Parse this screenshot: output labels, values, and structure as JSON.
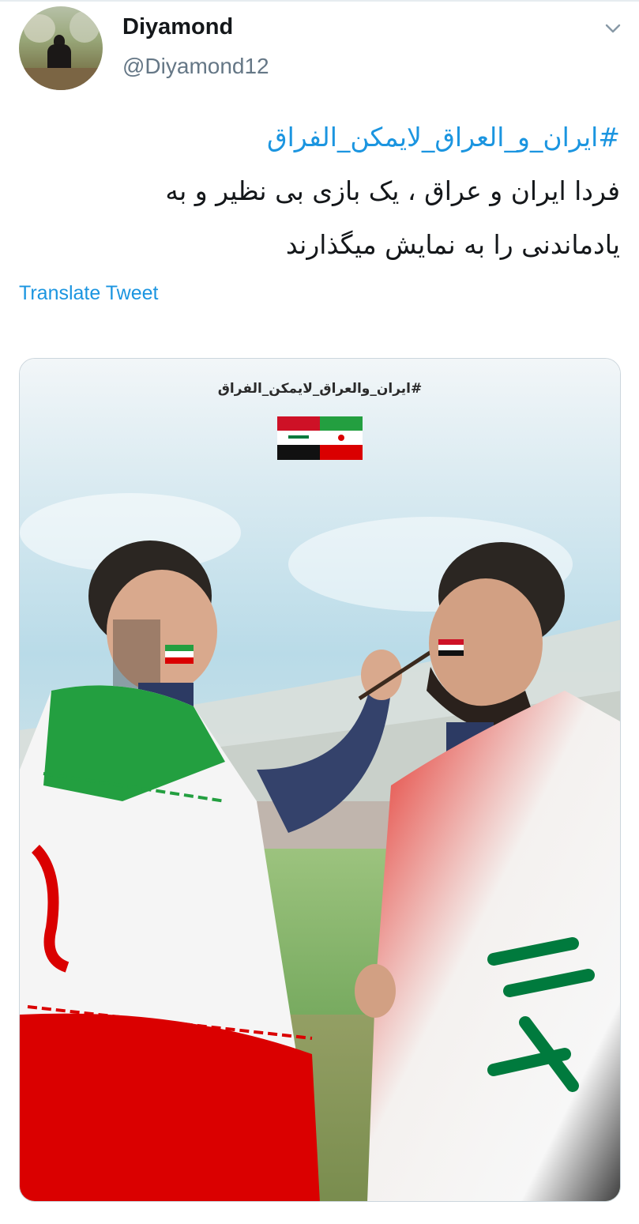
{
  "user": {
    "display_name": "Diyamond",
    "handle": "@Diyamond12",
    "avatar_icon": "avatar-photo"
  },
  "tweet": {
    "hashtag": "#ایران_و_العراق_لایمکن_الفراق",
    "line1": "فردا  ایران و عراق ، یک بازی بی نظیر و به",
    "line2": "یادماندنی را به نمایش میگذارند",
    "translate_label": "Translate Tweet"
  },
  "media": {
    "poster_hashtag": "#ایران_والعراق_لایمکن_الفراق",
    "flag_left_text": "الله اكبر"
  },
  "colors": {
    "link": "#1b95e0",
    "text": "#14171a",
    "secondary": "#657786",
    "iran_green": "#239f40",
    "iran_red": "#da0000",
    "iraq_red": "#ce1126",
    "iraq_green": "#007a3d"
  },
  "icons": {
    "menu": "chevron-down-icon"
  }
}
